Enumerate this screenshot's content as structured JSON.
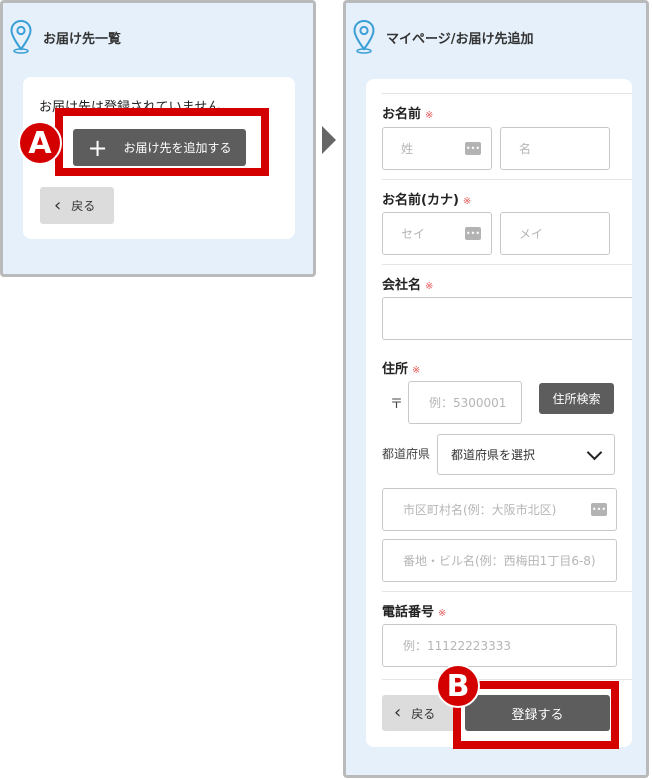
{
  "left_panel": {
    "title": "お届け先一覧",
    "empty_message": "お届け先は登録されていません。",
    "add_button_label": "お届け先を追加する",
    "back_button_label": "戻る",
    "icon": "location-pin-icon"
  },
  "right_panel": {
    "title": "マイページ/お届け先追加",
    "icon": "location-pin-icon",
    "required_mark": "※",
    "name": {
      "label": "お名前",
      "last_placeholder": "姓",
      "first_placeholder": "名"
    },
    "name_kana": {
      "label": "お名前(カナ)",
      "last_placeholder": "セイ",
      "first_placeholder": "メイ"
    },
    "company": {
      "label": "会社名",
      "value": ""
    },
    "address": {
      "label": "住所",
      "postal_mark": "〒",
      "postal_placeholder": "例：5300001",
      "search_button_label": "住所検索",
      "prefecture_label": "都道府県",
      "prefecture_selected": "都道府県を選択",
      "city_placeholder": "市区町村名(例：大阪市北区)",
      "street_placeholder": "番地・ビル名(例：西梅田1丁目6-8)"
    },
    "phone": {
      "label": "電話番号",
      "placeholder": "例：11122223333"
    },
    "back_button_label": "戻る",
    "register_button_label": "登録する"
  },
  "annotations": {
    "badge_a": "A",
    "badge_b": "B"
  },
  "colors": {
    "highlight": "#d40000",
    "panel_bg": "#e6f0fa",
    "dark_button": "#5d5d5d",
    "required": "#e25a5a",
    "pin": "#3a9fd6"
  }
}
